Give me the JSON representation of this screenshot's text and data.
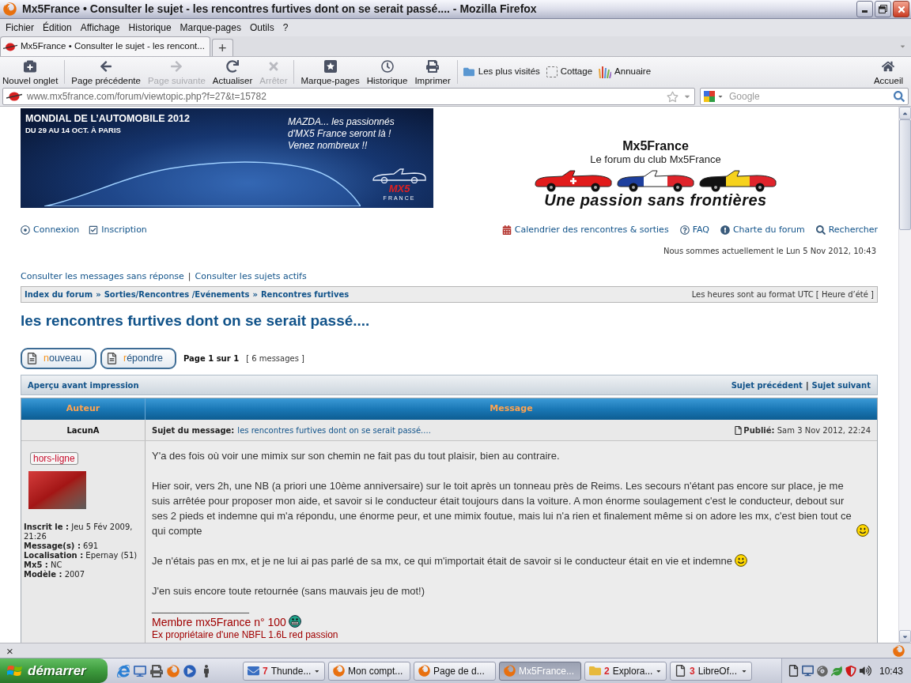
{
  "window": {
    "title": "Mx5France • Consulter le sujet - les rencontres furtives dont on se serait passé.... - Mozilla Firefox"
  },
  "menu_bar": [
    "Fichier",
    "Édition",
    "Affichage",
    "Historique",
    "Marque-pages",
    "Outils",
    "?"
  ],
  "tabs": [
    {
      "label": "Mx5France • Consulter le sujet - les rencont...",
      "selected": true
    }
  ],
  "new_tab_button": "+",
  "toolbar": [
    [
      {
        "kind": "new_tab",
        "label": "Nouvel onglet",
        "disabled": false
      }
    ],
    [
      {
        "kind": "back",
        "label": "Page précédente",
        "disabled": false
      },
      {
        "kind": "forward",
        "label": "Page suivante",
        "disabled": true
      },
      {
        "kind": "reload",
        "label": "Actualiser",
        "disabled": false
      },
      {
        "kind": "stop",
        "label": "Arrêter",
        "disabled": true
      }
    ],
    [
      {
        "kind": "bookmarks",
        "label": "Marque-pages",
        "disabled": false
      },
      {
        "kind": "history",
        "label": "Historique",
        "disabled": false
      },
      {
        "kind": "print",
        "label": "Imprimer",
        "disabled": false
      }
    ]
  ],
  "bookmarks_bar": [
    {
      "kind": "folder",
      "label": "Les plus visités"
    },
    {
      "kind": "page",
      "label": "Cottage"
    },
    {
      "kind": "directory",
      "label": "Annuaire"
    }
  ],
  "home_button": {
    "label": "Accueil"
  },
  "address_bar": {
    "value": "www.mx5france.com/forum/viewtopic.php?f=27&t=15782"
  },
  "search_bar": {
    "placeholder": "Google"
  },
  "banner": {
    "title": "MONDIAL DE L’AUTOMOBILE 2012",
    "dates": "DU 29 AU 14 OCT. À PARIS",
    "slogan": [
      "MAZDA... les passionnés",
      "d'MX5 France seront là !",
      "Venez nombreux !!"
    ],
    "logo": [
      "MX5",
      "FRANCE"
    ]
  },
  "site": {
    "title": "Mx5France",
    "subtitle": "Le forum du club Mx5France",
    "tagline": "Une passion sans frontières"
  },
  "nav_left": [
    {
      "kind": "login",
      "label": "Connexion"
    },
    {
      "kind": "register",
      "label": "Inscription"
    }
  ],
  "nav_right": [
    {
      "kind": "calendar",
      "label": "Calendrier des rencontres & sorties"
    },
    {
      "kind": "faq",
      "label": "FAQ"
    },
    {
      "kind": "rules",
      "label": "Charte du forum"
    },
    {
      "kind": "search",
      "label": "Rechercher"
    }
  ],
  "current_time": "Nous sommes actuellement le Lun 5 Nov 2012, 10:43",
  "quick_links": {
    "items": [
      "Consulter les messages sans réponse",
      "Consulter les sujets actifs"
    ],
    "separator": "|"
  },
  "breadcrumbs": {
    "items": [
      "Index du forum",
      "Sorties/Rencontres /Evénements",
      "Rencontres furtives"
    ],
    "separator": "»"
  },
  "timezone": "Les heures sont au format UTC [ Heure d’été ]",
  "topic_title": "les rencontres furtives dont on se serait passé....",
  "buttons": [
    "nouveau",
    "répondre"
  ],
  "pagination": {
    "pages": "Page 1 sur 1",
    "count": "[ 6 messages ]"
  },
  "topic_bar": {
    "print": "Aperçu avant impression",
    "links": [
      "Sujet précédent",
      "Sujet suivant"
    ],
    "separator": "|"
  },
  "table": {
    "columns": [
      "Auteur",
      "Message"
    ]
  },
  "posts": [
    {
      "author": "LacunA",
      "subject_label": "Sujet du message:",
      "subject": "les rencontres furtives dont on se serait passé....",
      "posted": "**Publié:** Sam 3 Nov 2012, 22:24",
      "status": "hors-ligne",
      "online": false,
      "profile": [
        "**Inscrit le :** Jeu 5 Fév 2009, 21:26",
        "**Message(s) :** 691",
        "**Localisation :** Epernay (51)",
        "**Mx5 :** NC",
        "**Modèle :** 2007"
      ],
      "body": [
        {
          "kind": "plain",
          "text": "Y'a des fois où voir une mimix sur son chemin ne fait pas du tout plaisir, bien au contraire."
        },
        {
          "kind": "smile",
          "text": "Hier soir, vers 2h, une NB (a priori une 10ème anniversaire) sur le toit après un tonneau près de Reims. Les secours n'étant pas encore sur place, je me suis arrêtée pour proposer mon aide, et savoir si le conducteur était toujours dans la voiture. A mon énorme soulagement c'est le conducteur, debout sur ses 2 pieds et indemne qui m'a répondu, une énorme peur, et une mimix foutue, mais lui n'a rien et finalement même si on adore les mx, c'est bien tout ce qui compte"
        },
        {
          "kind": "smile",
          "text": "Je n'étais pas en mx, et je ne lui ai pas parlé de sa mx, ce qui m'importait était de savoir si le conducteur était en vie et indemne"
        },
        {
          "kind": "plain",
          "text": "J'en suis encore toute retournée (sans mauvais jeu de mot!)"
        }
      ],
      "signature_separator": "_________________",
      "signature": [
        {
          "kind": "grin",
          "text": "Membre mx5France n° 100"
        },
        {
          "kind": "plain",
          "text": "Ex propriétaire d'une NBFL 1.6L red passion"
        }
      ]
    }
  ],
  "addon_bar": {
    "close": "×"
  },
  "taskbar": {
    "start": "démarrer",
    "tasks": [
      {
        "kind": "mail",
        "count": "7",
        "label": "Thunde...",
        "selected": false
      },
      {
        "kind": "firefox",
        "label": "Mon compt...",
        "selected": false
      },
      {
        "kind": "firefox",
        "label": "Page de d...",
        "selected": false
      },
      {
        "kind": "firefox",
        "label": "Mx5France...",
        "selected": true
      },
      {
        "kind": "folder",
        "count": "2",
        "label": "Explora...",
        "selected": false
      },
      {
        "kind": "document",
        "count": "3",
        "label": "LibreOf...",
        "selected": false
      }
    ],
    "clock": "10:43"
  }
}
